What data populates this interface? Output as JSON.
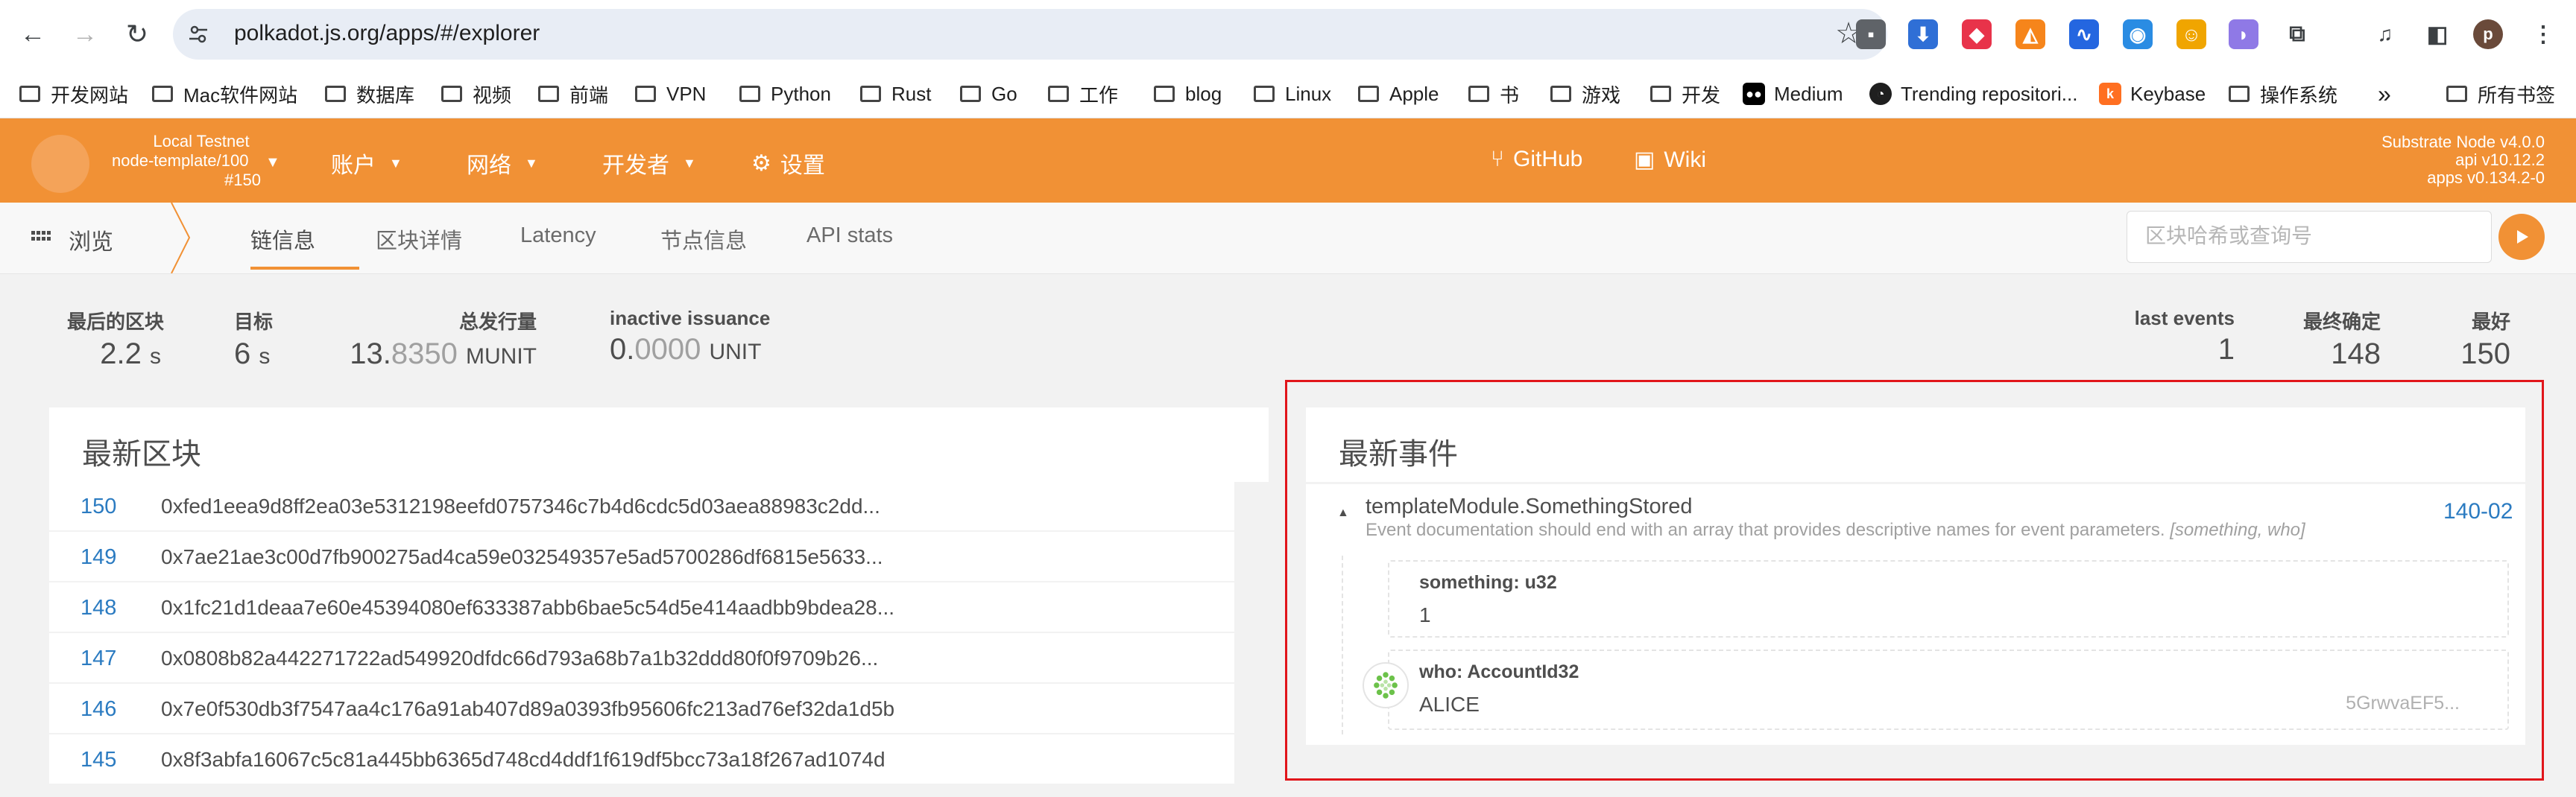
{
  "browser": {
    "url": "polkadot.js.org/apps/#/explorer",
    "bookmarks": [
      "开发网站",
      "Mac软件网站",
      "数据库",
      "视频",
      "前端",
      "VPN",
      "Python",
      "Rust",
      "Go",
      "工作",
      "blog",
      "Linux",
      "Apple",
      "书",
      "游戏",
      "开发",
      "Medium",
      "Trending repositori...",
      "Keybase",
      "操作系统"
    ],
    "all_bookmarks": "所有书签",
    "profile_initial": "p",
    "more": "»"
  },
  "app": {
    "chain": {
      "name": "Local Testnet",
      "node": "node-template/100",
      "block": "#150"
    },
    "menu": {
      "accounts": "账户",
      "network": "网络",
      "developer": "开发者",
      "settings": "设置",
      "github": "GitHub",
      "wiki": "Wiki"
    },
    "version": {
      "node": "Substrate Node v4.0.0",
      "api": "api v10.12.2",
      "apps": "apps v0.134.2-0"
    }
  },
  "subnav": {
    "browse": "浏览",
    "tabs": [
      "链信息",
      "区块详情",
      "Latency",
      "节点信息",
      "API stats"
    ],
    "active_tab": "链信息",
    "search_placeholder": "区块哈希或查询号"
  },
  "stats": {
    "last_block": {
      "label": "最后的区块",
      "value": "2.2",
      "unit": "s"
    },
    "target": {
      "label": "目标",
      "value": "6",
      "unit": "s"
    },
    "total_issuance": {
      "label": "总发行量",
      "value_main": "13.",
      "value_dim": "8350",
      "unit": "MUNIT"
    },
    "inactive_issuance": {
      "label": "inactive issuance",
      "value_main": "0.",
      "value_dim": "0000",
      "unit": "UNIT"
    },
    "last_events": {
      "label": "last events",
      "value": "1"
    },
    "finalized": {
      "label": "最终确定",
      "value": "148"
    },
    "best": {
      "label": "最好",
      "value": "150"
    }
  },
  "recent_blocks": {
    "title": "最新区块",
    "rows": [
      {
        "number": "150",
        "hash": "0xfed1eea9d8ff2ea03e5312198eefd0757346c7b4d6cdc5d03aea88983c2dd..."
      },
      {
        "number": "149",
        "hash": "0x7ae21ae3c00d7fb900275ad4ca59e032549357e5ad5700286df6815e5633..."
      },
      {
        "number": "148",
        "hash": "0x1fc21d1deaa7e60e45394080ef633387abb6bae5c54d5e414aadbb9bdea28..."
      },
      {
        "number": "147",
        "hash": "0x0808b82a442271722ad549920dfdc66d793a68b7a1b32ddd80f0f9709b26..."
      },
      {
        "number": "146",
        "hash": "0x7e0f530db3f7547aa4c176a91ab407d89a0393fb95606fc213ad76ef32da1d5b"
      },
      {
        "number": "145",
        "hash": "0x8f3abfa16067c5c81a445bb6365d748cd4ddf1f619df5bcc73a18f267ad1074d"
      }
    ]
  },
  "recent_events": {
    "title": "最新事件",
    "event": {
      "name": "templateModule.SomethingStored",
      "doc": "Event documentation should end with an array that provides descriptive names for event parameters.",
      "doc_params": "[something, who]",
      "id": "140-02",
      "params": [
        {
          "label": "something: u32",
          "value": "1"
        },
        {
          "label": "who: AccountId32",
          "value": "ALICE",
          "address": "5GrwvaEF5..."
        }
      ]
    }
  }
}
